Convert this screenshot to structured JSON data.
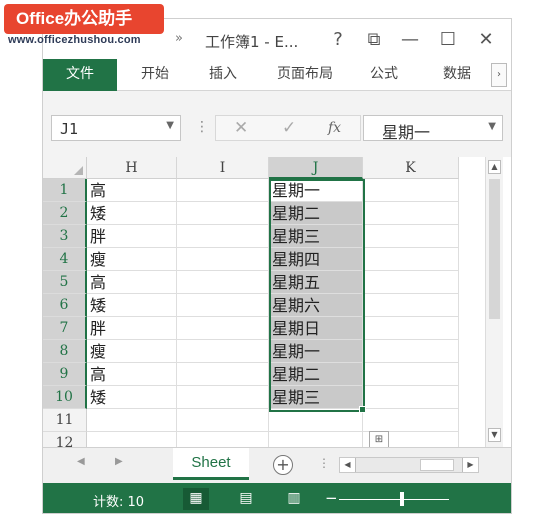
{
  "watermark": {
    "badge": "Office办公助手",
    "url": "www.officezhushou.com"
  },
  "titlebar": {
    "title": "工作簿1 - E...",
    "redo": "»",
    "help": "?",
    "restore": "⧉",
    "minimize": "—",
    "maximize": "☐",
    "close": "✕"
  },
  "ribbon": {
    "tabs": [
      {
        "label": "文件",
        "active": true
      },
      {
        "label": "开始"
      },
      {
        "label": "插入"
      },
      {
        "label": "页面布局"
      },
      {
        "label": "公式"
      },
      {
        "label": "数据"
      }
    ],
    "scroll": "›"
  },
  "formula_bar": {
    "name_box": "J1",
    "dots": "⋮",
    "cancel": "✕",
    "enter": "✓",
    "fx": "fx",
    "value": "星期一"
  },
  "grid": {
    "columns": [
      "H",
      "I",
      "J",
      "K"
    ],
    "selected_column": "J",
    "rows": [
      {
        "num": "1",
        "H": "高",
        "J": "星期一"
      },
      {
        "num": "2",
        "H": "矮",
        "J": "星期二"
      },
      {
        "num": "3",
        "H": "胖",
        "J": "星期三"
      },
      {
        "num": "4",
        "H": "瘦",
        "J": "星期四"
      },
      {
        "num": "5",
        "H": "高",
        "J": "星期五"
      },
      {
        "num": "6",
        "H": "矮",
        "J": "星期六"
      },
      {
        "num": "7",
        "H": "胖",
        "J": "星期日"
      },
      {
        "num": "8",
        "H": "瘦",
        "J": "星期一"
      },
      {
        "num": "9",
        "H": "高",
        "J": "星期二"
      },
      {
        "num": "10",
        "H": "矮",
        "J": "星期三"
      },
      {
        "num": "11",
        "H": "",
        "J": ""
      },
      {
        "num": "12",
        "H": "",
        "J": ""
      }
    ]
  },
  "sheets": {
    "tabs": [
      "Sheet"
    ],
    "add": "+",
    "dots": "⋮"
  },
  "status": {
    "count": "计数: 10"
  },
  "colors": {
    "accent": "#217346",
    "selection_shade": "#c9c9c9"
  }
}
